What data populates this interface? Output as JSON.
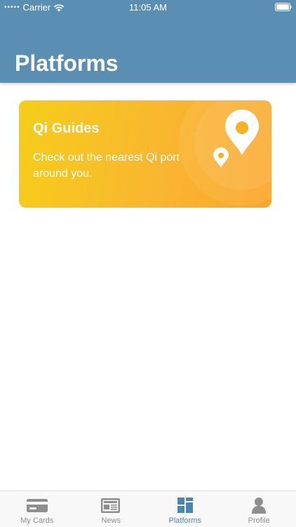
{
  "status_bar": {
    "signal": "•••••",
    "carrier": "Carrier",
    "time": "11:05 AM"
  },
  "header": {
    "title": "Platforms"
  },
  "card": {
    "title": "Qi Guides",
    "description": "Check out the nearest Qi port around you."
  },
  "tabbar": {
    "tabs": [
      {
        "label": "My Cards",
        "icon": "card-icon"
      },
      {
        "label": "News",
        "icon": "newspaper-icon"
      },
      {
        "label": "Platforms",
        "icon": "grid-icon",
        "active": true
      },
      {
        "label": "Profile",
        "icon": "person-icon"
      }
    ]
  },
  "colors": {
    "header": "#5a8fb3",
    "card_start": "#f6cd1a",
    "card_end": "#fba52a",
    "tab_active": "#4a86b0",
    "tab_inactive": "#8e8e8e"
  }
}
